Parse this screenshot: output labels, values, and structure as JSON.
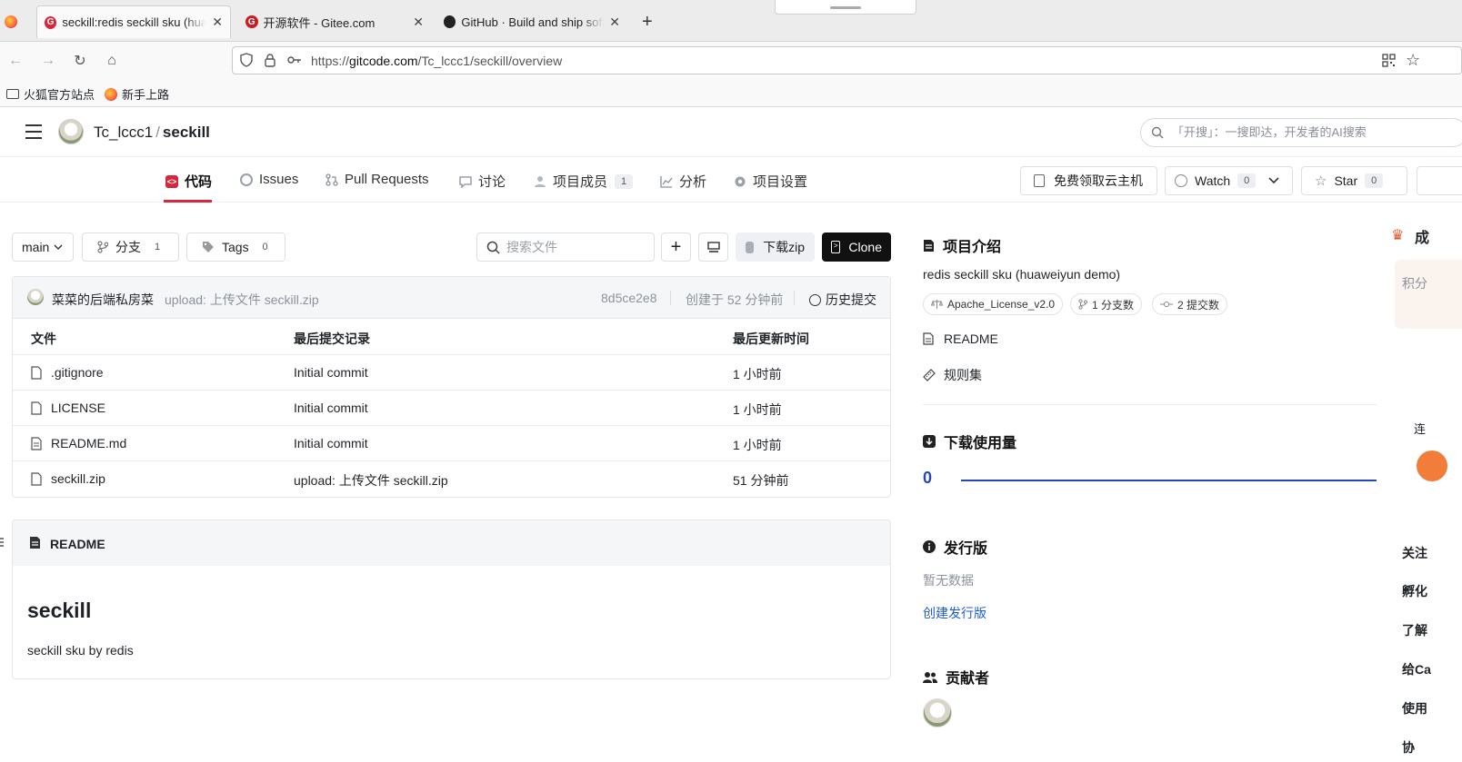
{
  "browser": {
    "tabs": [
      {
        "title": "seckill:redis seckill sku (huaweiyun demo)",
        "active": true
      },
      {
        "title": "开源软件 - Gitee.com",
        "active": false
      },
      {
        "title": "GitHub · Build and ship software",
        "active": false
      }
    ],
    "url_prefix": "https://",
    "url_host": "gitcode.com",
    "url_path": "/Tc_lccc1/seckill/overview",
    "bookmarks": [
      "火狐官方站点",
      "新手上路"
    ]
  },
  "header": {
    "owner": "Tc_lccc1",
    "separator": "/",
    "repo": "seckill",
    "search_placeholder": "「开搜」：一搜即达，开发者的AI搜索"
  },
  "subnav": {
    "tabs": [
      {
        "label": "代码",
        "active": true
      },
      {
        "label": "Issues"
      },
      {
        "label": "Pull Requests"
      },
      {
        "label": "讨论"
      },
      {
        "label": "项目成员",
        "count": "1"
      },
      {
        "label": "分析"
      },
      {
        "label": "项目设置"
      }
    ],
    "cloud_label": "免费领取云主机",
    "watch_label": "Watch",
    "watch_count": "0",
    "star_label": "Star",
    "star_count": "0"
  },
  "toolbar": {
    "branch": "main",
    "branches_label": "分支",
    "branches_count": "1",
    "tags_label": "Tags",
    "tags_count": "0",
    "search_placeholder": "搜索文件",
    "zip_label": "下载zip",
    "clone_label": "Clone"
  },
  "commit": {
    "author": "菜菜的后端私房菜",
    "message": "upload: 上传文件 seckill.zip",
    "hash": "8d5ce2e8",
    "time": "创建于 52 分钟前",
    "history_label": "历史提交"
  },
  "files": {
    "headers": [
      "文件",
      "最后提交记录",
      "最后更新时间"
    ],
    "rows": [
      {
        "name": ".gitignore",
        "commit": "Initial commit",
        "time": "1 小时前"
      },
      {
        "name": "LICENSE",
        "commit": "Initial commit",
        "time": "1 小时前"
      },
      {
        "name": "README.md",
        "commit": "Initial commit",
        "time": "1 小时前"
      },
      {
        "name": "seckill.zip",
        "commit": "upload: 上传文件 seckill.zip",
        "time": "51 分钟前"
      }
    ]
  },
  "readme": {
    "label": "README",
    "heading": "seckill",
    "body": "seckill sku by redis"
  },
  "sidebar": {
    "intro_title": "项目介绍",
    "description": "redis seckill sku (huaweiyun demo)",
    "license": "Apache_License_v2.0",
    "branches": "1 分支数",
    "commits": "2 提交数",
    "readme_link": "README",
    "rules_link": "规则集",
    "downloads_title": "下载使用量",
    "downloads_value": "0",
    "releases_title": "发行版",
    "releases_empty": "暂无数据",
    "releases_create": "创建发行版",
    "contributors_title": "贡献者"
  },
  "far_right": {
    "items": [
      "成",
      "积分",
      "连",
      "关注",
      "孵化",
      "了解",
      "给Ca",
      "使用",
      "协"
    ]
  },
  "colors": {
    "brand_red": "#d8263a",
    "link_blue": "#1f5bd8",
    "download_line": "#2346b8"
  }
}
